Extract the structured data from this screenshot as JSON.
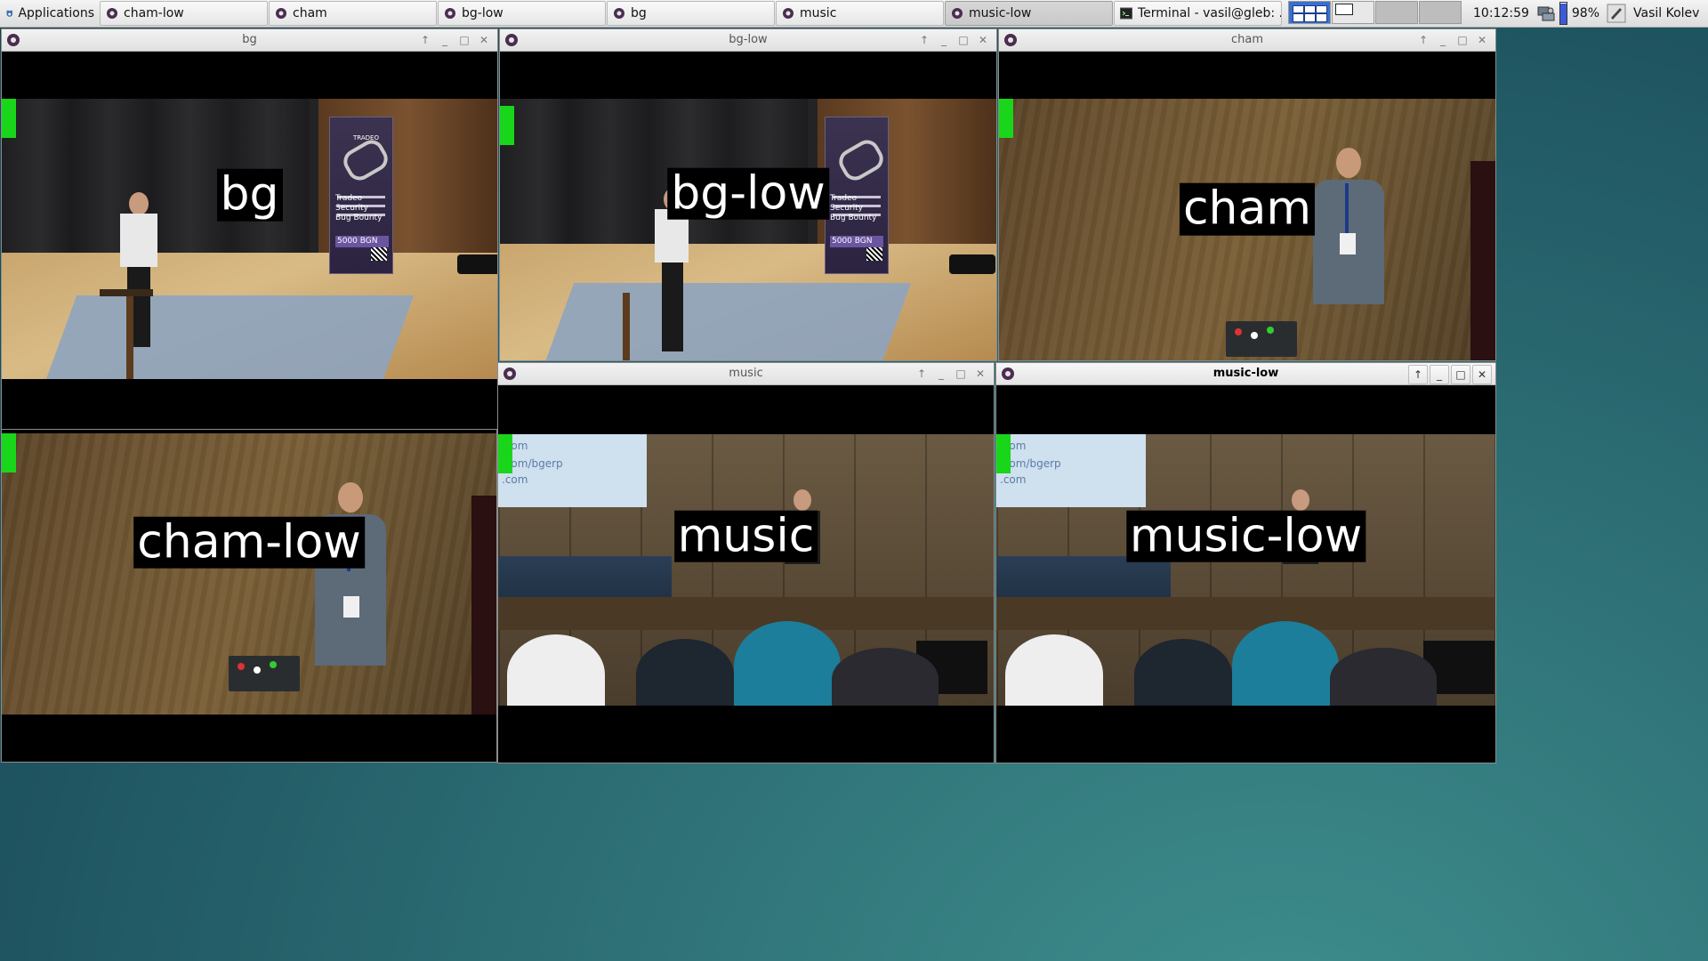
{
  "taskbar": {
    "apps_label": "Applications",
    "tasks": [
      {
        "label": "cham-low"
      },
      {
        "label": "cham"
      },
      {
        "label": "bg-low"
      },
      {
        "label": "bg"
      },
      {
        "label": "music"
      },
      {
        "label": "music-low"
      },
      {
        "label": "Terminal - vasil@gleb: ..."
      }
    ],
    "active_task": "music-low",
    "clock": "10:12:59",
    "battery": "98%",
    "user": "Vasil Kolev"
  },
  "windows": [
    {
      "id": "bg",
      "title": "bg",
      "overlay": "bg"
    },
    {
      "id": "bg-low",
      "title": "bg-low",
      "overlay": "bg-low"
    },
    {
      "id": "cham",
      "title": "cham",
      "overlay": "cham"
    },
    {
      "id": "cham-low",
      "title": "",
      "overlay": "cham-low"
    },
    {
      "id": "music",
      "title": "music",
      "overlay": "music"
    },
    {
      "id": "music-low",
      "title": "music-low",
      "overlay": "music-low"
    }
  ],
  "banner": {
    "brand": "TRADEO",
    "lines": [
      "Tradeo",
      "Security",
      "Bug Bounty"
    ],
    "prize": "5000 BGN"
  },
  "slide": {
    "lines": [
      ".com",
      ".com/bgerp",
      ".com"
    ]
  },
  "colors": {
    "desktop": "#2f7378",
    "green_marker": "#19d61a",
    "titlebar": "#e6e6e6",
    "pager_active": "#3b6fcf"
  },
  "icons": {
    "app_menu": "xfce-mouse-icon",
    "video_window": "video-player-icon",
    "terminal": "terminal-icon",
    "network": "network-icon",
    "user": "user-icon"
  }
}
